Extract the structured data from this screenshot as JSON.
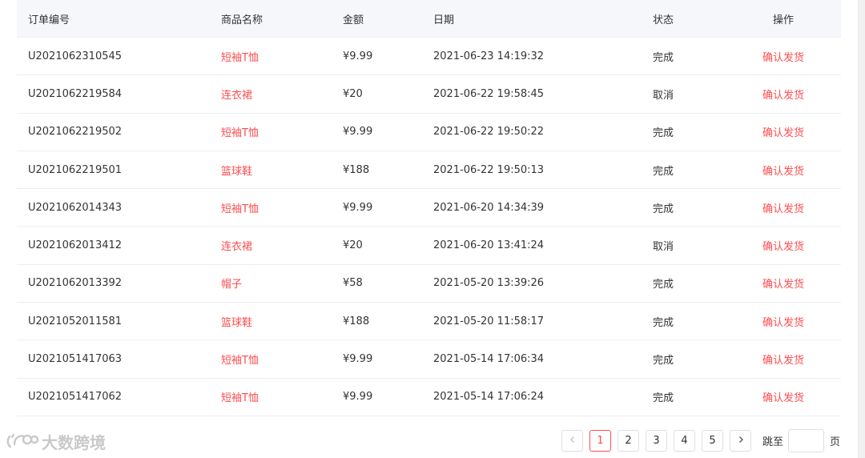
{
  "table": {
    "headers": {
      "order_no": "订单编号",
      "product": "商品名称",
      "amount": "金额",
      "date": "日期",
      "status": "状态",
      "action": "操作"
    },
    "rows": [
      {
        "order_no": "U2021062310545",
        "product": "短袖T恤",
        "amount": "¥9.99",
        "date": "2021-06-23 14:19:32",
        "status": "完成",
        "action": "确认发货"
      },
      {
        "order_no": "U2021062219584",
        "product": "连衣裙",
        "amount": "¥20",
        "date": "2021-06-22 19:58:45",
        "status": "取消",
        "action": "确认发货"
      },
      {
        "order_no": "U2021062219502",
        "product": "短袖T恤",
        "amount": "¥9.99",
        "date": "2021-06-22 19:50:22",
        "status": "完成",
        "action": "确认发货"
      },
      {
        "order_no": "U2021062219501",
        "product": "篮球鞋",
        "amount": "¥188",
        "date": "2021-06-22 19:50:13",
        "status": "完成",
        "action": "确认发货"
      },
      {
        "order_no": "U2021062014343",
        "product": "短袖T恤",
        "amount": "¥9.99",
        "date": "2021-06-20 14:34:39",
        "status": "完成",
        "action": "确认发货"
      },
      {
        "order_no": "U2021062013412",
        "product": "连衣裙",
        "amount": "¥20",
        "date": "2021-06-20 13:41:24",
        "status": "取消",
        "action": "确认发货"
      },
      {
        "order_no": "U2021062013392",
        "product": "帽子",
        "amount": "¥58",
        "date": "2021-05-20 13:39:26",
        "status": "完成",
        "action": "确认发货"
      },
      {
        "order_no": "U2021052011581",
        "product": "篮球鞋",
        "amount": "¥188",
        "date": "2021-05-20 11:58:17",
        "status": "完成",
        "action": "确认发货"
      },
      {
        "order_no": "U2021051417063",
        "product": "短袖T恤",
        "amount": "¥9.99",
        "date": "2021-05-14 17:06:34",
        "status": "完成",
        "action": "确认发货"
      },
      {
        "order_no": "U2021051417062",
        "product": "短袖T恤",
        "amount": "¥9.99",
        "date": "2021-05-14 17:06:24",
        "status": "完成",
        "action": "确认发货"
      }
    ]
  },
  "pagination": {
    "prev_icon": "chevron-left-icon",
    "pages": [
      "1",
      "2",
      "3",
      "4",
      "5"
    ],
    "current_page": "1",
    "next_icon": "chevron-right-icon",
    "jump_label": "跳至",
    "jump_value": "",
    "page_unit": "页"
  },
  "watermark": {
    "text": "大数跨境",
    "icon": "brand-logo-icon"
  },
  "colors": {
    "accent": "#ff4d4f",
    "header_bg": "#f5f7fa",
    "border": "#ebeef5"
  }
}
